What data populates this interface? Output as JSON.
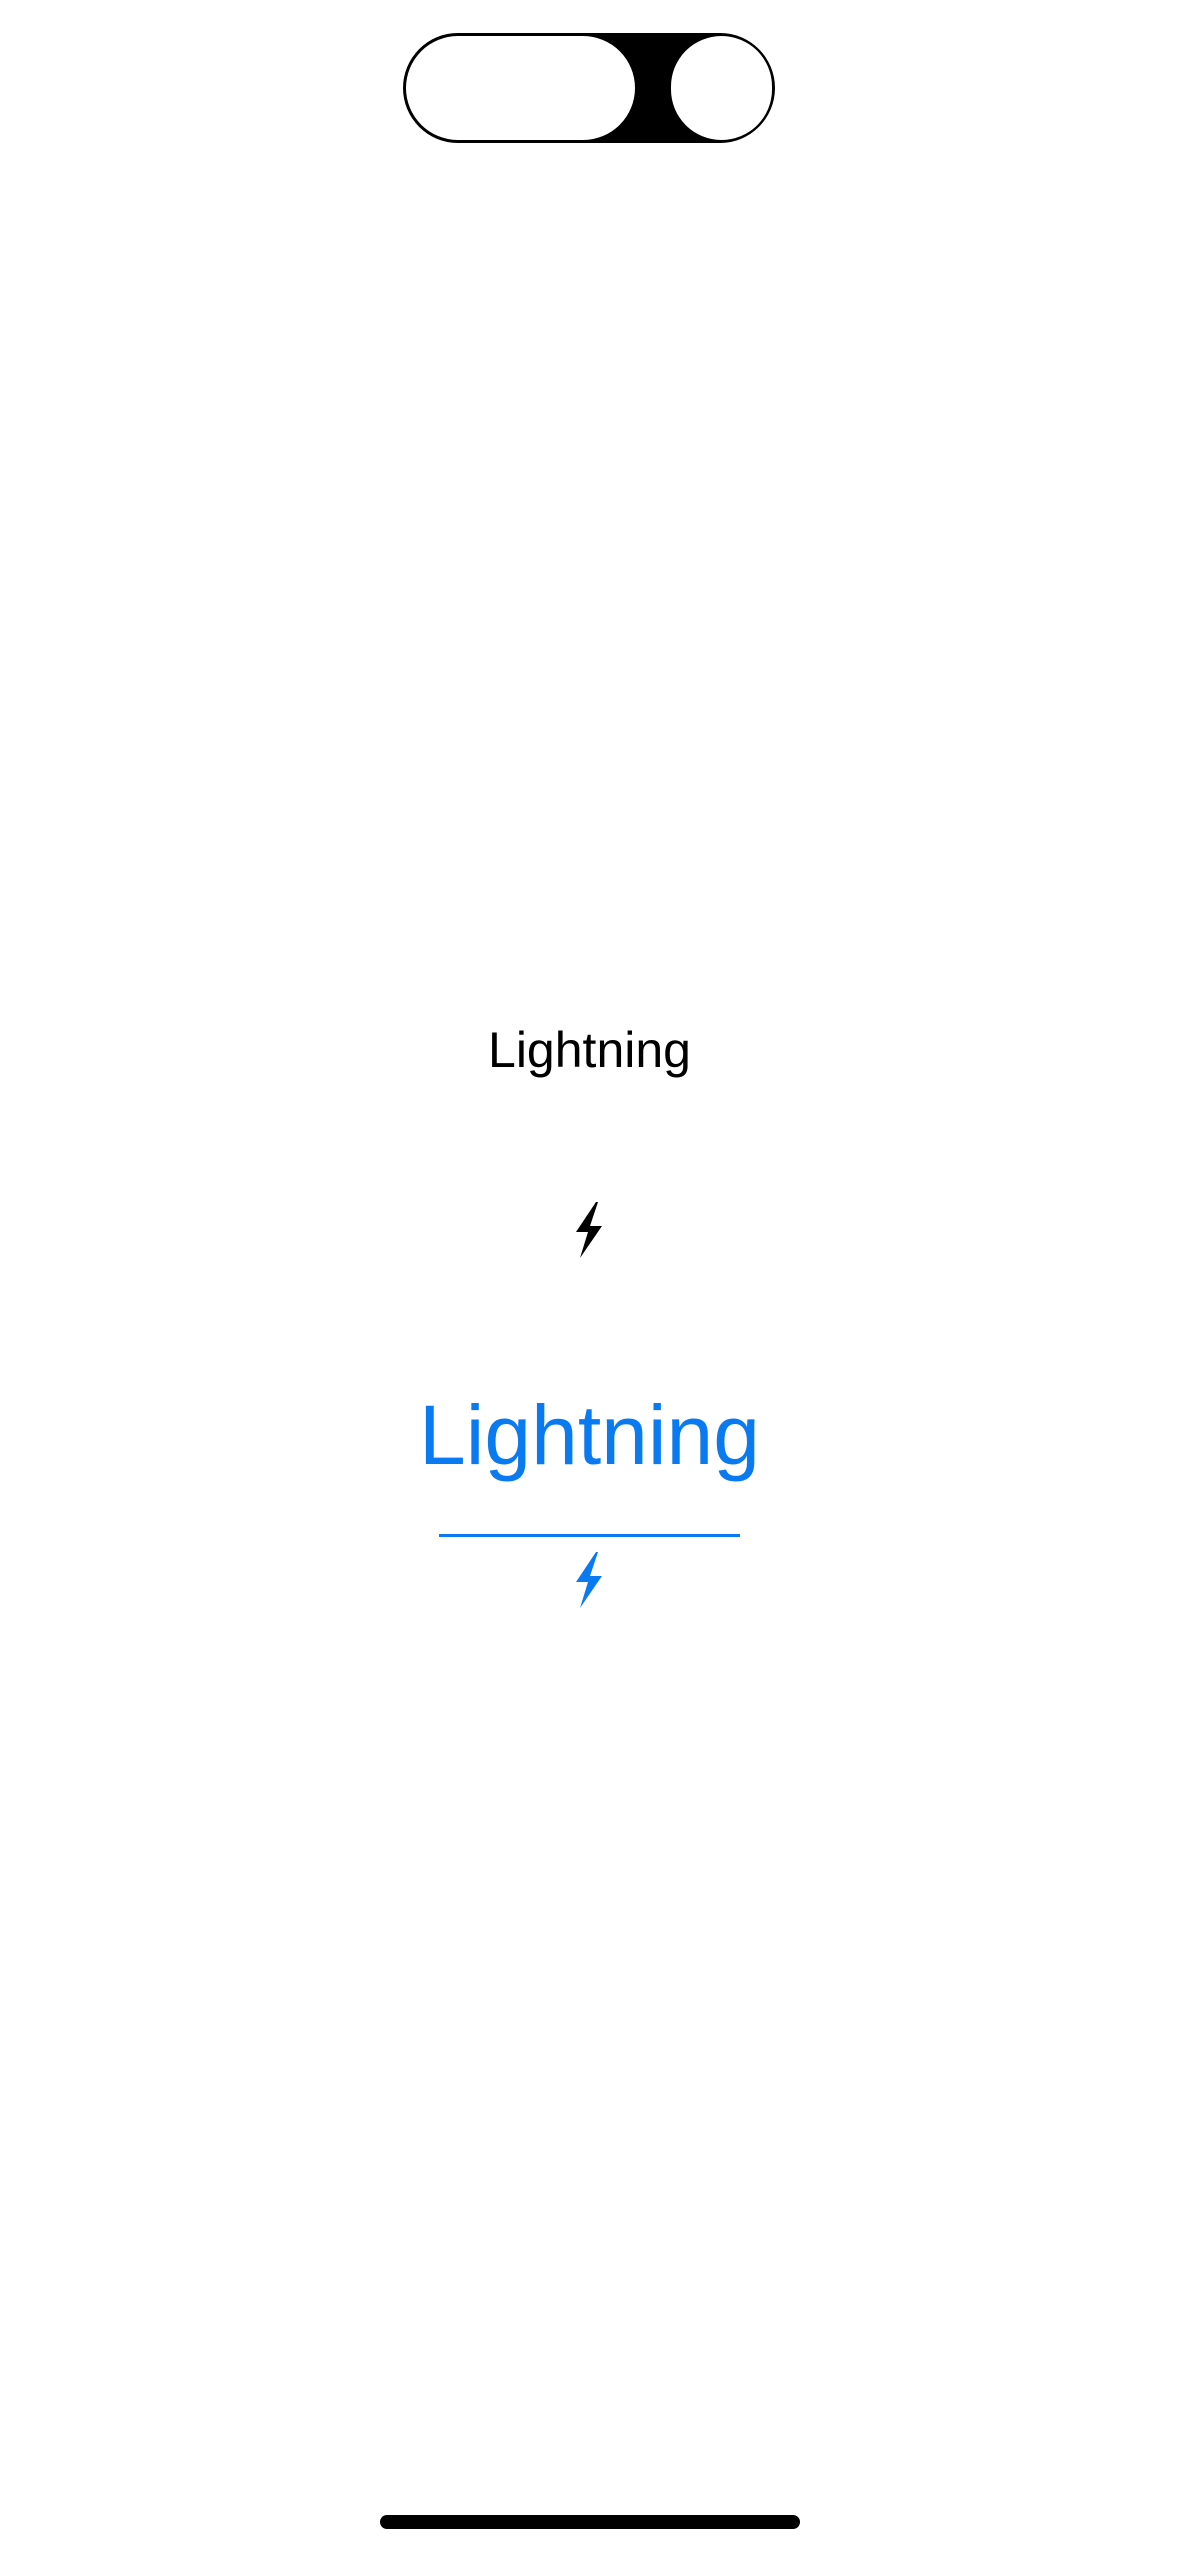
{
  "content": {
    "primary_label": "Lightning",
    "secondary_label": "Lightning",
    "icons": {
      "black": "lightning-bolt-icon",
      "blue": "lightning-bolt-icon"
    }
  },
  "colors": {
    "accent": "#0a7af0",
    "text": "#000000",
    "background": "#ffffff"
  }
}
